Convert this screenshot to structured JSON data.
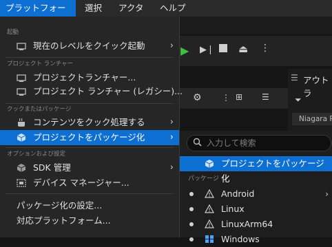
{
  "menubar": {
    "items": [
      "プラットフォーム",
      "選択",
      "アクタ",
      "ヘルプ"
    ]
  },
  "toolbar": {
    "viewport_right_label": "アウトラ",
    "niagara_label": "Niagara P"
  },
  "main_menu": {
    "sections": {
      "launch": "起動",
      "project_launcher": "プロジェクト ランチャー",
      "cook": "クックまたはパッケージ",
      "options": "オプションおよび設定"
    },
    "items": {
      "quick_launch": "現在のレベルをクイック起動",
      "project_launcher": "プロジェクトランチャー...",
      "project_launcher_legacy": "プロジェクト ランチャー (レガシー)...",
      "cook_content": "コンテンツをクック処理する",
      "package_project": "プロジェクトをパッケージ化",
      "sdk_manager": "SDK 管理",
      "device_manager": "デバイス マネージャー...",
      "packaging_settings": "パッケージ化の設定...",
      "supported_platforms": "対応プラットフォーム..."
    }
  },
  "submenu": {
    "search_placeholder": "入力して検索",
    "package_project": "プロジェクトをパッケージ化",
    "section_packages": "パッケージ",
    "platforms": [
      "Android",
      "Linux",
      "LinuxArm64",
      "Windows"
    ]
  }
}
